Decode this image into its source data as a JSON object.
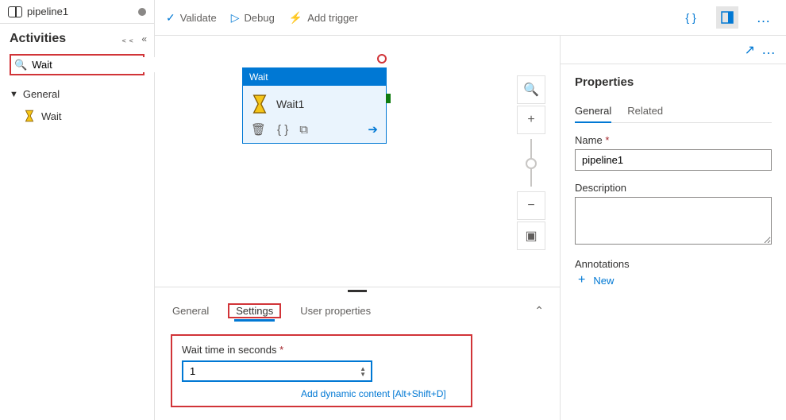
{
  "tab": {
    "title": "pipeline1"
  },
  "activities": {
    "heading": "Activities",
    "search_value": "Wait",
    "group_label": "General",
    "item_label": "Wait"
  },
  "toolbar": {
    "validate": "Validate",
    "debug": "Debug",
    "add_trigger": "Add trigger"
  },
  "canvas": {
    "node_type": "Wait",
    "node_name": "Wait1"
  },
  "bottom_tabs": {
    "general": "General",
    "settings": "Settings",
    "user_props": "User properties"
  },
  "settings": {
    "wait_label": "Wait time in seconds",
    "wait_value": "1",
    "dyn_link": "Add dynamic content [Alt+Shift+D]"
  },
  "properties": {
    "title": "Properties",
    "tab_general": "General",
    "tab_related": "Related",
    "name_label": "Name",
    "name_value": "pipeline1",
    "desc_label": "Description",
    "desc_value": "",
    "annotations_label": "Annotations",
    "new_label": "New"
  }
}
